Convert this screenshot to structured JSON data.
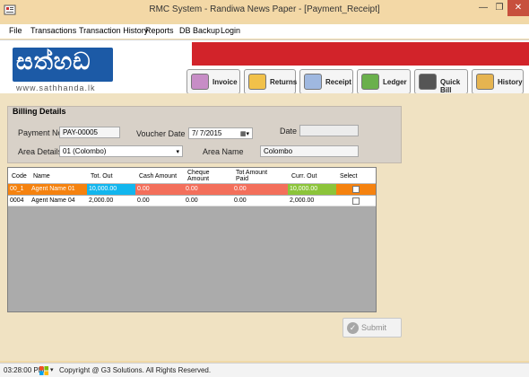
{
  "window": {
    "title": "RMC System - Randiwa News Paper - [Payment_Receipt]",
    "minimize_glyph": "—",
    "maximize_glyph": "❐",
    "close_glyph": "✕"
  },
  "menu": {
    "items": [
      "File",
      "Transactions",
      "Transaction History",
      "Reports",
      "DB Backup",
      "Login"
    ]
  },
  "header": {
    "logo_text": "සත්හඩ",
    "logo_url": "www.sathhanda.lk",
    "toolbar": [
      {
        "label": "Invoice",
        "icon": "invoice-icon",
        "color": "#c78dc6"
      },
      {
        "label": "Returns",
        "icon": "returns-icon",
        "color": "#f1c14a"
      },
      {
        "label": "Receipt",
        "icon": "receipt-icon",
        "color": "#9fb8e0"
      },
      {
        "label": "Ledger",
        "icon": "ledger-icon",
        "color": "#6ab04c"
      },
      {
        "label": "Quick Bill",
        "icon": "calculator-icon",
        "color": "#555555"
      },
      {
        "label": "History",
        "icon": "history-icon",
        "color": "#e6b450"
      }
    ]
  },
  "billing": {
    "section_title": "Billing Details",
    "payment_no_label": "Payment No",
    "payment_no_value": "PAY-00005",
    "voucher_date_label": "Voucher Date",
    "voucher_date_value": "7/  7/2015",
    "date_label": "Date",
    "date_value": "",
    "area_details_label": "Area Details",
    "area_details_value": "01 (Colombo)",
    "area_name_label": "Area Name",
    "area_name_value": "Colombo"
  },
  "grid": {
    "columns": [
      "Code",
      "Name",
      "Tot. Out",
      "Cash Amount",
      "Cheque Amount",
      "Tot Amount Paid",
      "Curr. Out",
      "Select"
    ],
    "rows": [
      {
        "code": "00_1",
        "name": "Agent Name 01",
        "tot_out": "10,000.00",
        "cash": "0.00",
        "cheque": "0.00",
        "paid": "0.00",
        "curr_out": "10,000.00",
        "selected": false
      },
      {
        "code": "0004",
        "name": "Agent Name 04",
        "tot_out": "2,000.00",
        "cash": "0.00",
        "cheque": "0.00",
        "paid": "0.00",
        "curr_out": "2,000.00",
        "selected": false
      }
    ]
  },
  "actions": {
    "submit_label": "Submit"
  },
  "status": {
    "time": "03:28:00 PM",
    "copyright": "Copyright @ G3 Solutions.  All  Rights Reserved."
  },
  "colors": {
    "titlebar": "#f3d8a6",
    "logo_blue": "#1c5aa6",
    "brand_red": "#d2232a",
    "row_selected": "#f5820f",
    "cell_blue": "#12b6ee",
    "cell_red": "#f36f5b",
    "cell_green": "#8cc43a"
  }
}
